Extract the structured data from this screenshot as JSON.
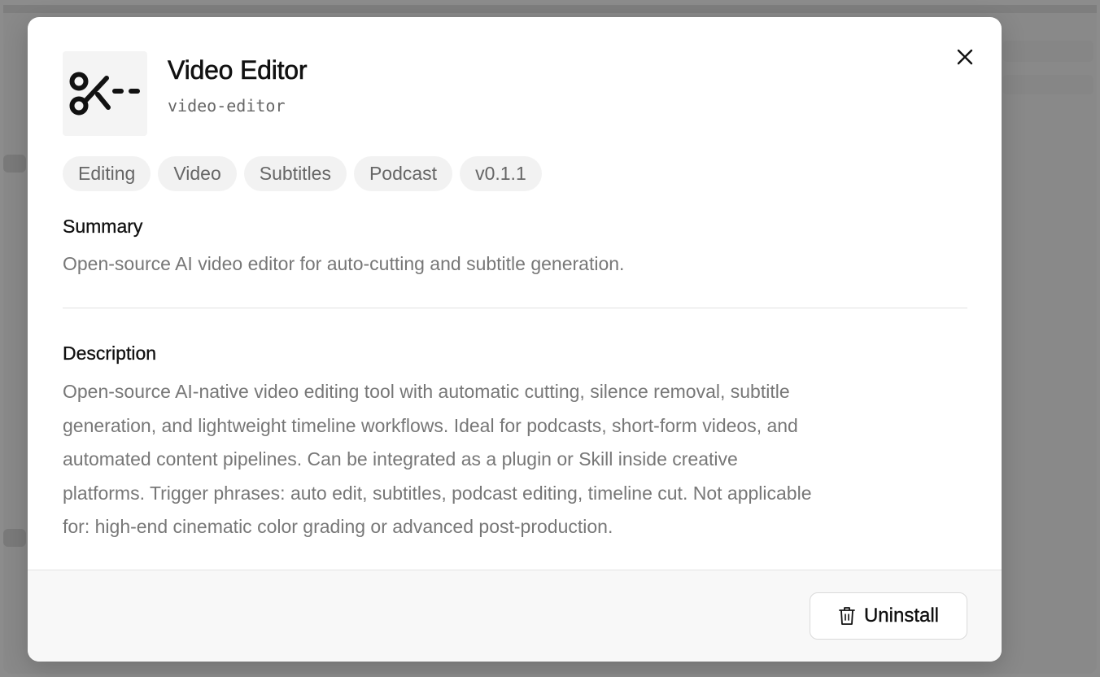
{
  "app": {
    "name": "Video Editor",
    "slug": "video-editor",
    "icon": "scissors-cut-icon"
  },
  "tags": [
    "Editing",
    "Video",
    "Subtitles",
    "Podcast",
    "v0.1.1"
  ],
  "summary": {
    "heading": "Summary",
    "text": "Open-source AI video editor for auto-cutting and subtitle generation."
  },
  "description": {
    "heading": "Description",
    "lines": [
      "Open-source AI-native video editing tool with automatic cutting, silence removal, subtitle",
      "generation, and lightweight timeline workflows. Ideal for podcasts, short-form videos, and",
      "automated content pipelines. Can be integrated as a plugin or Skill inside creative",
      "platforms. Trigger phrases: auto edit, subtitles, podcast editing, timeline cut. Not applicable",
      "for: high-end cinematic color grading or advanced post-production."
    ]
  },
  "footer": {
    "uninstall_label": "Uninstall",
    "uninstall_icon": "trash-icon"
  },
  "close_icon": "close-icon",
  "colors": {
    "overlay": "#8a8a8a",
    "modal_bg": "#ffffff",
    "tag_bg": "#f2f2f2",
    "muted_text": "#777777",
    "footer_bg": "#f8f8f8"
  }
}
